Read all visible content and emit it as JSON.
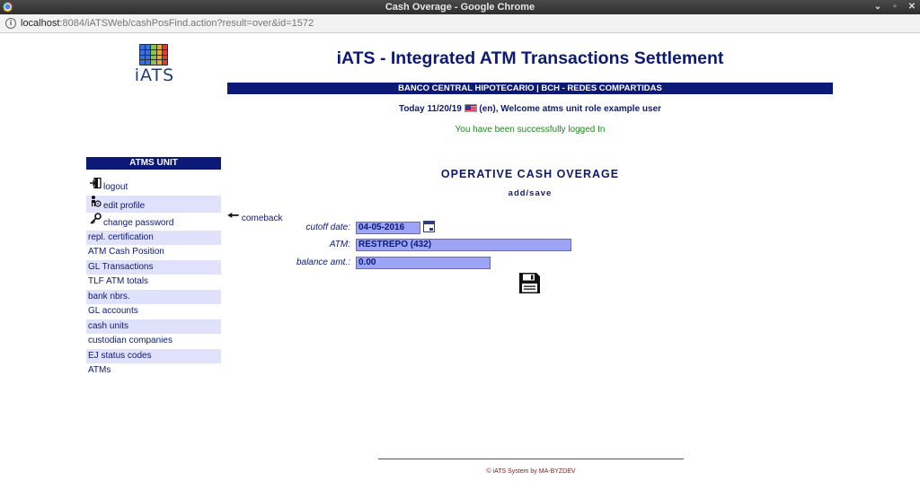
{
  "window": {
    "title": "Cash Overage - Google Chrome",
    "controls": [
      "⌄",
      "▫",
      "✕"
    ]
  },
  "browser": {
    "url_host": "localhost",
    "url_rest": ":8084/iATSWeb/cashPosFind.action?result=over&id=1572"
  },
  "logo": {
    "text": "iATS"
  },
  "header": {
    "title": "iATS - Integrated ATM Transactions Settlement",
    "bank": "BANCO CENTRAL HIPOTECARIO | BCH - REDES COMPARTIDAS",
    "welcome_pre": "Today 11/20/19",
    "welcome_post": "(en), Welcome atms unit role example user",
    "logged_in": "You have been successfully logged In"
  },
  "sidebar": {
    "heading": "ATMS UNIT",
    "user_items": [
      {
        "label": "logout",
        "icon": "logout-icon"
      },
      {
        "label": "edit profile",
        "icon": "edit-profile-icon"
      },
      {
        "label": "change password",
        "icon": "key-icon"
      }
    ],
    "items": [
      "repl. certification",
      "ATM Cash Position",
      "GL Transactions",
      "TLF ATM totals",
      "bank nbrs.",
      "GL accounts",
      "cash units",
      "custodian companies",
      "EJ status codes",
      "ATMs"
    ]
  },
  "comeback": {
    "label": "comeback"
  },
  "form": {
    "title": "OPERATIVE CASH OVERAGE",
    "subtitle": "add/save",
    "cutoff_label": "cutoff date:",
    "cutoff_value": "04-05-2016",
    "atm_label": "ATM:",
    "atm_value": "RESTREPO (432)",
    "balance_label": "balance amt.:",
    "balance_value": "0.00"
  },
  "footer": {
    "text": "© iATS System by MA-BYZDEV"
  },
  "colors": {
    "navy": "#0c1976",
    "field": "#9da4f6",
    "menu_alt": "#e0e1fb",
    "success": "#1b8a1b"
  }
}
